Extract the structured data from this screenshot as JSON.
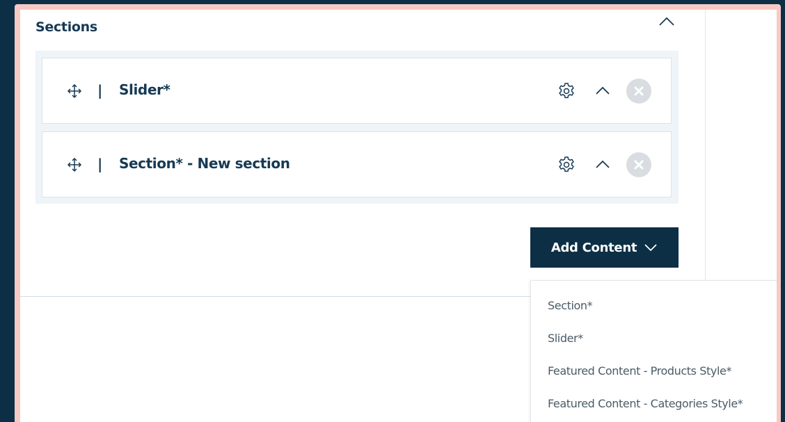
{
  "panel": {
    "title": "Sections"
  },
  "sections": [
    {
      "title": "Slider*"
    },
    {
      "title": "Section* - New section"
    }
  ],
  "separator": "|",
  "add_content": {
    "label": "Add Content",
    "options": [
      "Section*",
      "Slider*",
      "Featured Content - Products Style*",
      "Featured Content - Categories Style*"
    ]
  },
  "colors": {
    "navy": "#0d2f45",
    "title_text": "#173a54",
    "frame_accent": "#f7c9c4",
    "box_bg": "#eef4f8",
    "remove_bg": "#d9dde1"
  },
  "icons": [
    "chevron-up-icon",
    "move-icon",
    "gear-icon",
    "close-icon",
    "chevron-down-icon"
  ]
}
